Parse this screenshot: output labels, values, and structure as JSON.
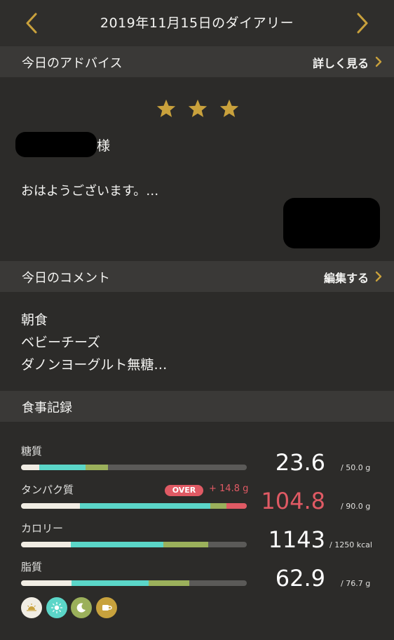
{
  "header": {
    "title": "2019年11月15日のダイアリー"
  },
  "advice": {
    "section_label": "今日のアドバイス",
    "link_label": "詳しく見る",
    "star_count": 3,
    "name_suffix": "様",
    "text": "おはようございます。…"
  },
  "comment": {
    "section_label": "今日のコメント",
    "link_label": "編集する",
    "lines": [
      "朝食",
      "ベビーチーズ",
      "ダノンヨーグルト無糖…"
    ]
  },
  "meals": {
    "section_label": "食事記録",
    "nutrients": [
      {
        "name": "糖質",
        "value": "23.6",
        "unit": "/ 50.0 g",
        "over": false,
        "segments": {
          "breakfast": 0.08,
          "lunch": 0.205,
          "dinner": 0.1,
          "snack": 0.0
        }
      },
      {
        "name": "タンパク質",
        "value": "104.8",
        "unit": "/ 90.0 g",
        "over": true,
        "over_label": "OVER",
        "over_amount": "+ 14.8 g",
        "segments": {
          "breakfast": 0.26,
          "lunch": 0.58,
          "dinner": 0.07,
          "snack": 0.0
        }
      },
      {
        "name": "カロリー",
        "value": "1143",
        "unit": "/ 1250 kcal",
        "over": false,
        "segments": {
          "breakfast": 0.22,
          "lunch": 0.41,
          "dinner": 0.2,
          "snack": 0.0
        }
      },
      {
        "name": "脂質",
        "value": "62.9",
        "unit": "/ 76.7 g",
        "over": false,
        "segments": {
          "breakfast": 0.225,
          "lunch": 0.34,
          "dinner": 0.18,
          "snack": 0.0
        }
      }
    ],
    "meal_icons": [
      {
        "name": "breakfast-icon",
        "color": "#f1ede4"
      },
      {
        "name": "lunch-icon",
        "color": "#5bd6c8"
      },
      {
        "name": "dinner-icon",
        "color": "#9bb05b"
      },
      {
        "name": "snack-icon",
        "color": "#c8a23d"
      }
    ]
  },
  "colors": {
    "accent": "#c9a13c",
    "over": "#e05a64",
    "breakfast": "#f1ede4",
    "lunch": "#5bd6c8",
    "dinner": "#9bb05b",
    "track": "#5b5a58"
  }
}
